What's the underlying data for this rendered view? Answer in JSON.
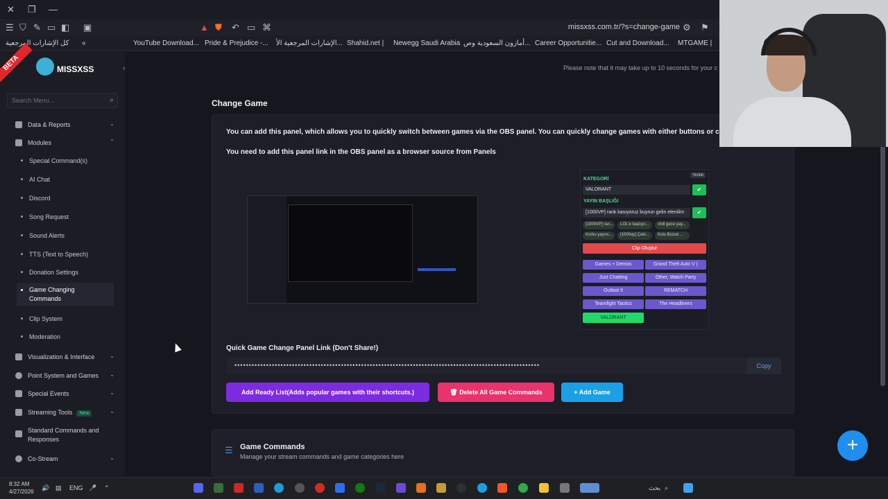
{
  "browser": {
    "url": "missxss.com.tr/?s=change-game",
    "bookmarks": [
      "كل الإشارات المرجعية",
      "YouTube Download...",
      "Pride & Prejudice -...",
      "الإشارات المرجعية الأ...",
      "Shahid.net |",
      "Newegg Saudi Arabia",
      "أمازون السعودية وص...",
      "Career Opportunitie...",
      "Cut and Download...",
      "MTGAME |"
    ]
  },
  "app": {
    "beta": "BETA",
    "brand": "MISSXSS",
    "notice": "Please note that it may take up to 10 seconds for your c",
    "search_placeholder": "Search Menu...",
    "nav": [
      {
        "label": "Data & Reports"
      },
      {
        "label": "Modules"
      },
      {
        "label": "Visualization & Interface"
      },
      {
        "label": "Point System and Games"
      },
      {
        "label": "Special Events"
      },
      {
        "label": "Streaming Tools",
        "badge": "New"
      },
      {
        "label": "Standard Commands and Responses"
      },
      {
        "label": "Co-Stream"
      }
    ],
    "modules": [
      "Special Command(s)",
      "AI Chat",
      "Discord",
      "Song Request",
      "Sound Alerts",
      "TTS (Text to Speech)",
      "Donation Settings",
      "Game Changing Commands",
      "Clip System",
      "Moderation"
    ]
  },
  "main": {
    "title": "Change Game",
    "desc1": "You can add this panel, which allows you to quickly switch between games via the OBS panel. You can quickly change games with either buttons or co",
    "desc2": "You need to add this panel link in the OBS panel as a browser source from Panels",
    "link_label": "Quick Game Change Panel Link (Don't Share!)",
    "link_value": "••••••••••••••••••••••••••••••••••••••••••••••••••••••••••••••••••••••••••••••••••••••••••••••••••••••••••",
    "copy": "Copy",
    "btn_ready": "Add Ready List(Adds popular games with their shortcuts.)",
    "btn_delete": "Delete All Game Commands",
    "btn_add": "Add Game",
    "commands_title": "Game Commands",
    "commands_sub": "Manage your stream commands and game categories here"
  },
  "preview": {
    "refresh": "Yenile",
    "kategori": "KATEGORİ",
    "category_value": "VALORANT",
    "yayin": "YAYIN BAŞLIĞI",
    "title_value": "[1000VP] rank kasıyoruz buyrun gelin elenilim",
    "pills": [
      "[1000VP] ran...",
      "LOL'e başlıyo...",
      "chill gece yay...",
      "Korku yayını...",
      "[1000vp] Çeki...",
      "Kolu Bozuk ..."
    ],
    "clip": "Clip Oluştur",
    "games": [
      "Games + Demos",
      "Grand Theft Auto V (",
      "Just Chatting",
      "Other, Watch Party",
      "Outlast II",
      "REMATCH",
      "Teamfight Tactics",
      "The Headliners"
    ],
    "active_game": "VALORANT"
  },
  "taskbar": {
    "time": "8:32 AM",
    "date": "4/27/2026",
    "lang": "ENG",
    "search": "بحث"
  }
}
